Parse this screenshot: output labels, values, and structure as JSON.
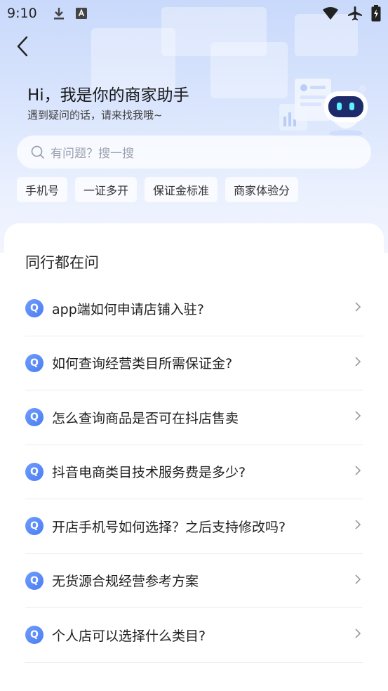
{
  "status_bar": {
    "time": "9:10",
    "left_icons": [
      "download-icon",
      "keyboard-a-icon"
    ],
    "right_icons": [
      "wifi-icon",
      "airplane-icon",
      "battery-charging-icon"
    ]
  },
  "header": {
    "back_icon": "chevron-left-icon",
    "greeting": "Hi，我是你的商家助手",
    "subtitle": "遇到疑问的话，请来找我哦~"
  },
  "search": {
    "placeholder": "有问题？搜一搜"
  },
  "chips": [
    {
      "label": "手机号"
    },
    {
      "label": "一证多开"
    },
    {
      "label": "保证金标准"
    },
    {
      "label": "商家体验分"
    }
  ],
  "faq": {
    "title": "同行都在问",
    "badge": "Q",
    "items": [
      {
        "text": "app端如何申请店铺入驻?"
      },
      {
        "text": "如何查询经营类目所需保证金?"
      },
      {
        "text": "怎么查询商品是否可在抖店售卖"
      },
      {
        "text": "抖音电商类目技术服务费是多少?"
      },
      {
        "text": "开店手机号如何选择？之后支持修改吗?"
      },
      {
        "text": "无货源合规经营参考方案"
      },
      {
        "text": "个人店可以选择什么类目?"
      }
    ]
  },
  "colors": {
    "accent": "#4b7ef5",
    "hero_top": "#c9d9fb",
    "hero_bottom": "#f2f5fe"
  }
}
